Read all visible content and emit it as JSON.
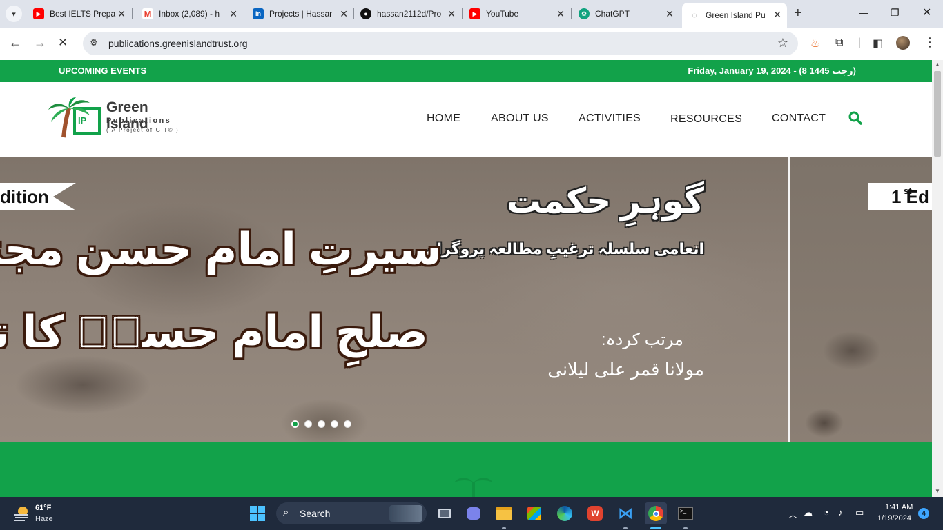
{
  "browser": {
    "tabs": [
      {
        "title": "Best IELTS Prepa",
        "favicon": "youtube-icon",
        "color": "#ff0000"
      },
      {
        "title": "Inbox (2,089) - h",
        "favicon": "gmail-icon",
        "color": "#ea4335"
      },
      {
        "title": "Projects | Hassar",
        "favicon": "linkedin-icon",
        "color": "#0a66c2"
      },
      {
        "title": "hassan2112d/Pro",
        "favicon": "github-icon",
        "color": "#111111"
      },
      {
        "title": "YouTube",
        "favicon": "youtube-icon",
        "color": "#ff0000"
      },
      {
        "title": "ChatGPT",
        "favicon": "chatgpt-icon",
        "color": "#10a37f"
      },
      {
        "title": "Green Island Pub",
        "favicon": "loading-icon",
        "color": "#888888",
        "active": true
      }
    ],
    "url": "publications.greenislandtrust.org"
  },
  "site": {
    "topbar": {
      "events_label": "UPCOMING EVENTS",
      "date": "Friday, January 19, 2024 -  (8 رجب 1445)"
    },
    "logo": {
      "title": "Green Island",
      "subtitle": "Publications",
      "tagline": "( A  Project  of  GIT® )",
      "mark": "IP"
    },
    "nav": [
      "HOME",
      "ABOUT US",
      "ACTIVITIES",
      "RESOURCES",
      "CONTACT"
    ],
    "slider": {
      "left_edition": "dition",
      "right_edition": "1   Ed",
      "right_edition_sup": "st",
      "title_line1": "سیرتِ امام حسن مجتبیٰؑ و",
      "title_line2": "صلحِ امام حسنؑ کا تجزیہ",
      "series_title": "گوہرِ حکمت",
      "series_subtitle": "انعامی سلسلہ ترغیبِ مطالعہ پروگرام",
      "compiled_by": "مرتب کردہ:",
      "author": "مولانا قمر علی لیلانی",
      "dots_count": 5,
      "active_dot": 0
    }
  },
  "taskbar": {
    "weather_temp": "61°F",
    "weather_desc": "Haze",
    "search_label": "Search",
    "time": "1:41 AM",
    "date": "1/19/2024",
    "notifications": "4"
  },
  "colors": {
    "brand_green": "#12a24a",
    "taskbar": "#1f2a3c"
  }
}
